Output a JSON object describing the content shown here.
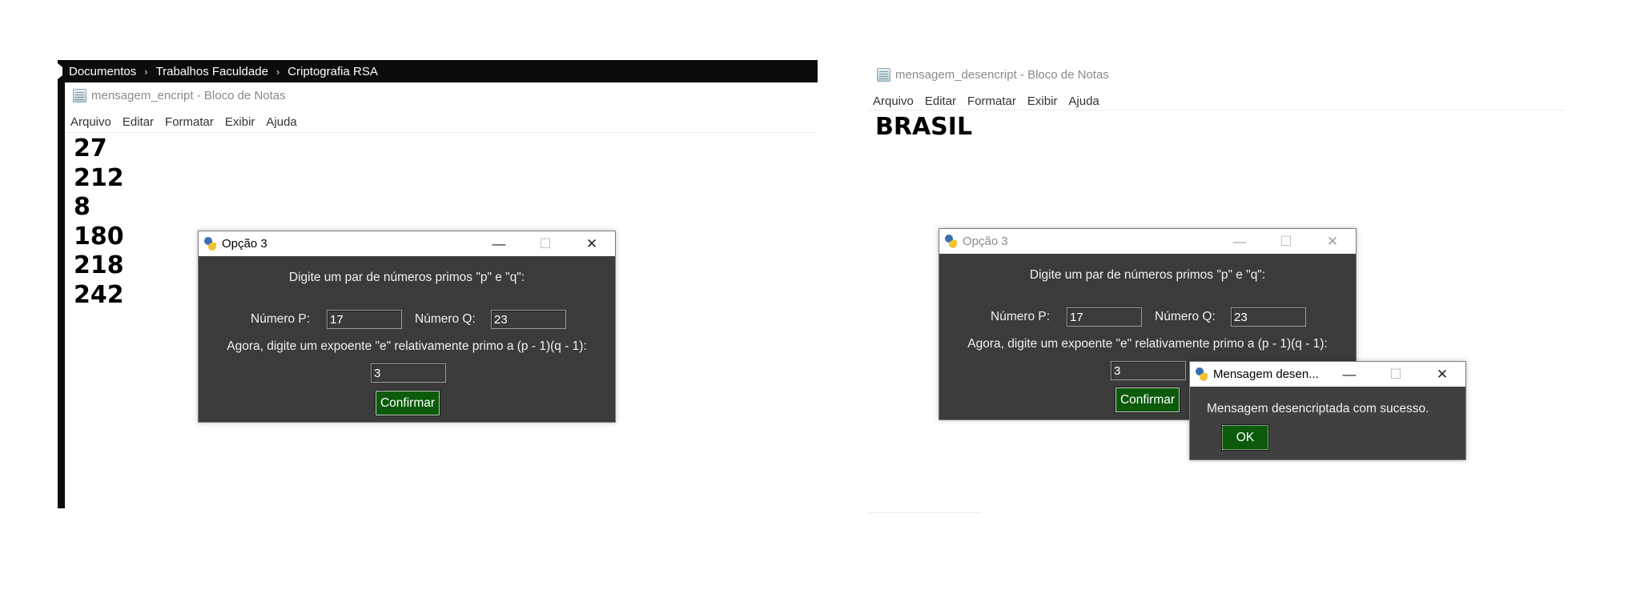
{
  "explorer": {
    "breadcrumbs": [
      "Documentos",
      "Trabalhos Faculdade",
      "Criptografia RSA"
    ]
  },
  "left_notepad": {
    "title": "mensagem_encript - Bloco de Notas",
    "menu": [
      "Arquivo",
      "Editar",
      "Formatar",
      "Exibir",
      "Ajuda"
    ],
    "lines": [
      "27",
      "212",
      "8",
      "180",
      "218",
      "242"
    ]
  },
  "right_notepad": {
    "title": "mensagem_desencript - Bloco de Notas",
    "menu": [
      "Arquivo",
      "Editar",
      "Formatar",
      "Exibir",
      "Ajuda"
    ],
    "text": "BRASIL"
  },
  "dialog_left": {
    "title": "Opção 3",
    "prompt": "Digite um par de números primos \"p\" e \"q\":",
    "label_p": "Número P:",
    "value_p": "17",
    "label_q": "Número Q:",
    "value_q": "23",
    "prompt_e": "Agora, digite um expoente \"e\" relativamente primo a (p - 1)(q - 1):",
    "value_e": "3",
    "confirm": "Confirmar"
  },
  "dialog_right": {
    "title": "Opção 3",
    "prompt": "Digite um par de números primos \"p\" e \"q\":",
    "label_p": "Número P:",
    "value_p": "17",
    "label_q": "Número Q:",
    "value_q": "23",
    "prompt_e": "Agora, digite um expoente \"e\" relativamente primo a (p - 1)(q - 1):",
    "value_e": "3",
    "confirm": "Confirmar"
  },
  "message_box": {
    "title": "Mensagem desen...",
    "message": "Mensagem desencriptada com sucesso.",
    "ok": "OK"
  },
  "window_controls": {
    "minimize": "—",
    "maximize": "☐",
    "close": "✕"
  },
  "colors": {
    "tk_bg": "#3b3b3b",
    "button_green": "#0c5a0c",
    "explorer_bar": "#0c0c0c"
  }
}
